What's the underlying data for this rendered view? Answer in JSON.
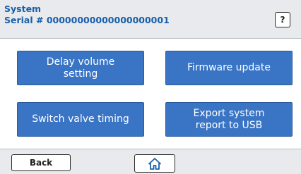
{
  "header": {
    "title": "System",
    "serial_label": "Serial # ",
    "serial_value": "00000000000000000001",
    "help_label": "?"
  },
  "menu": {
    "items": [
      {
        "label": "Delay volume\nsetting"
      },
      {
        "label": "Firmware update"
      },
      {
        "label": "Switch valve timing"
      },
      {
        "label": "Export system\nreport to USB"
      }
    ]
  },
  "footer": {
    "back_label": "Back",
    "home_icon": "home-icon"
  },
  "colors": {
    "accent": "#3a74c4",
    "title_text": "#1a5fa8",
    "panel_bg": "#e8eaed"
  }
}
